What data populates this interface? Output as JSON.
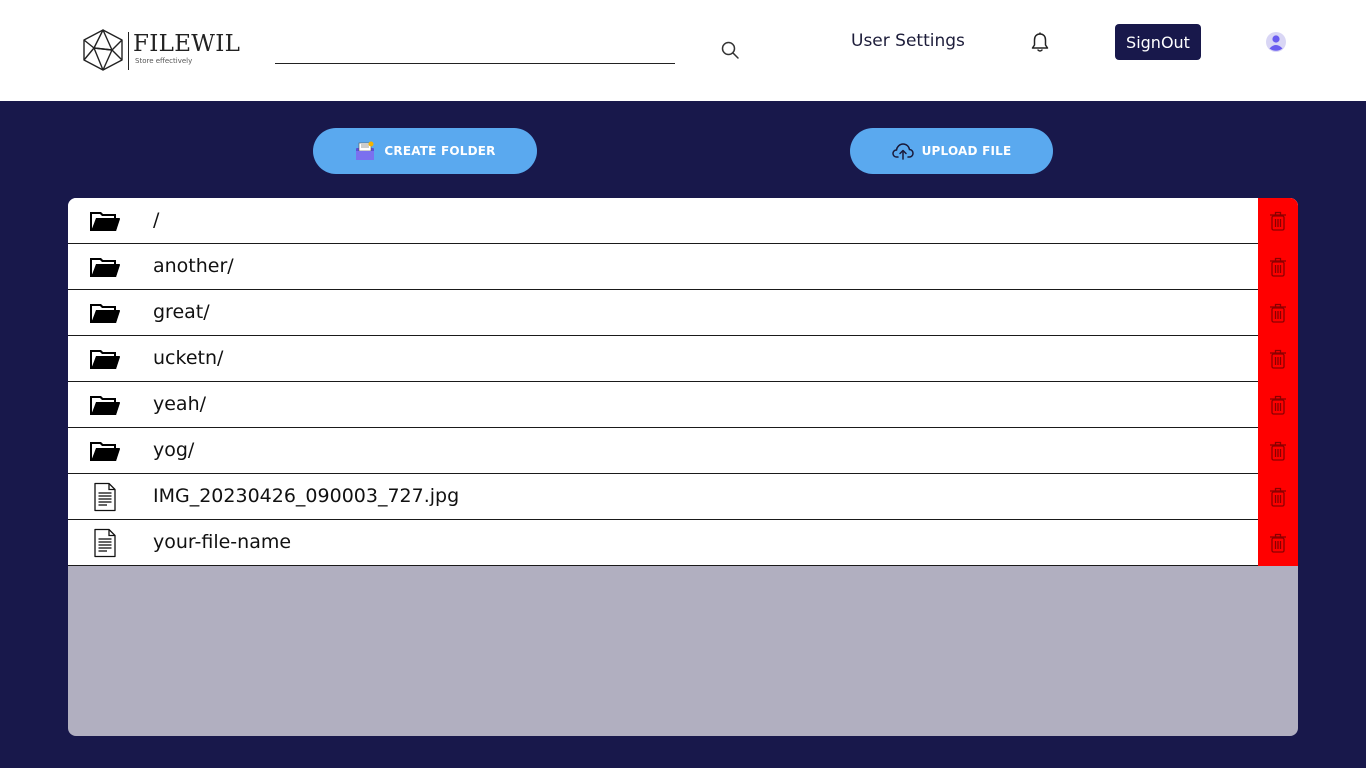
{
  "header": {
    "logo_title": "FILEWIL",
    "logo_tagline": "Store effectively",
    "search_placeholder": "",
    "user_settings_label": "User Settings",
    "signout_label": "SignOut"
  },
  "actions": {
    "create_folder_label": "CREATE FOLDER",
    "upload_file_label": "UPLOAD FILE"
  },
  "files": [
    {
      "name": "/",
      "type": "folder"
    },
    {
      "name": "another/",
      "type": "folder"
    },
    {
      "name": "great/",
      "type": "folder"
    },
    {
      "name": "ucketn/",
      "type": "folder"
    },
    {
      "name": "yeah/",
      "type": "folder"
    },
    {
      "name": "yog/",
      "type": "folder"
    },
    {
      "name": "IMG_20230426_090003_727.jpg",
      "type": "file"
    },
    {
      "name": "your-file-name",
      "type": "file"
    }
  ],
  "icons": {
    "logo": "polyhedron-logo-icon",
    "search": "search-icon",
    "bell": "bell-icon",
    "avatar": "user-avatar-icon",
    "create_folder": "folder-add-icon",
    "upload": "cloud-upload-icon",
    "folder": "folder-open-icon",
    "file": "document-icon",
    "delete": "trash-icon"
  },
  "colors": {
    "background": "#18184b",
    "header": "#ffffff",
    "action_button": "#5aa9ef",
    "delete": "#ff0000",
    "panel": "#b1afc0"
  }
}
